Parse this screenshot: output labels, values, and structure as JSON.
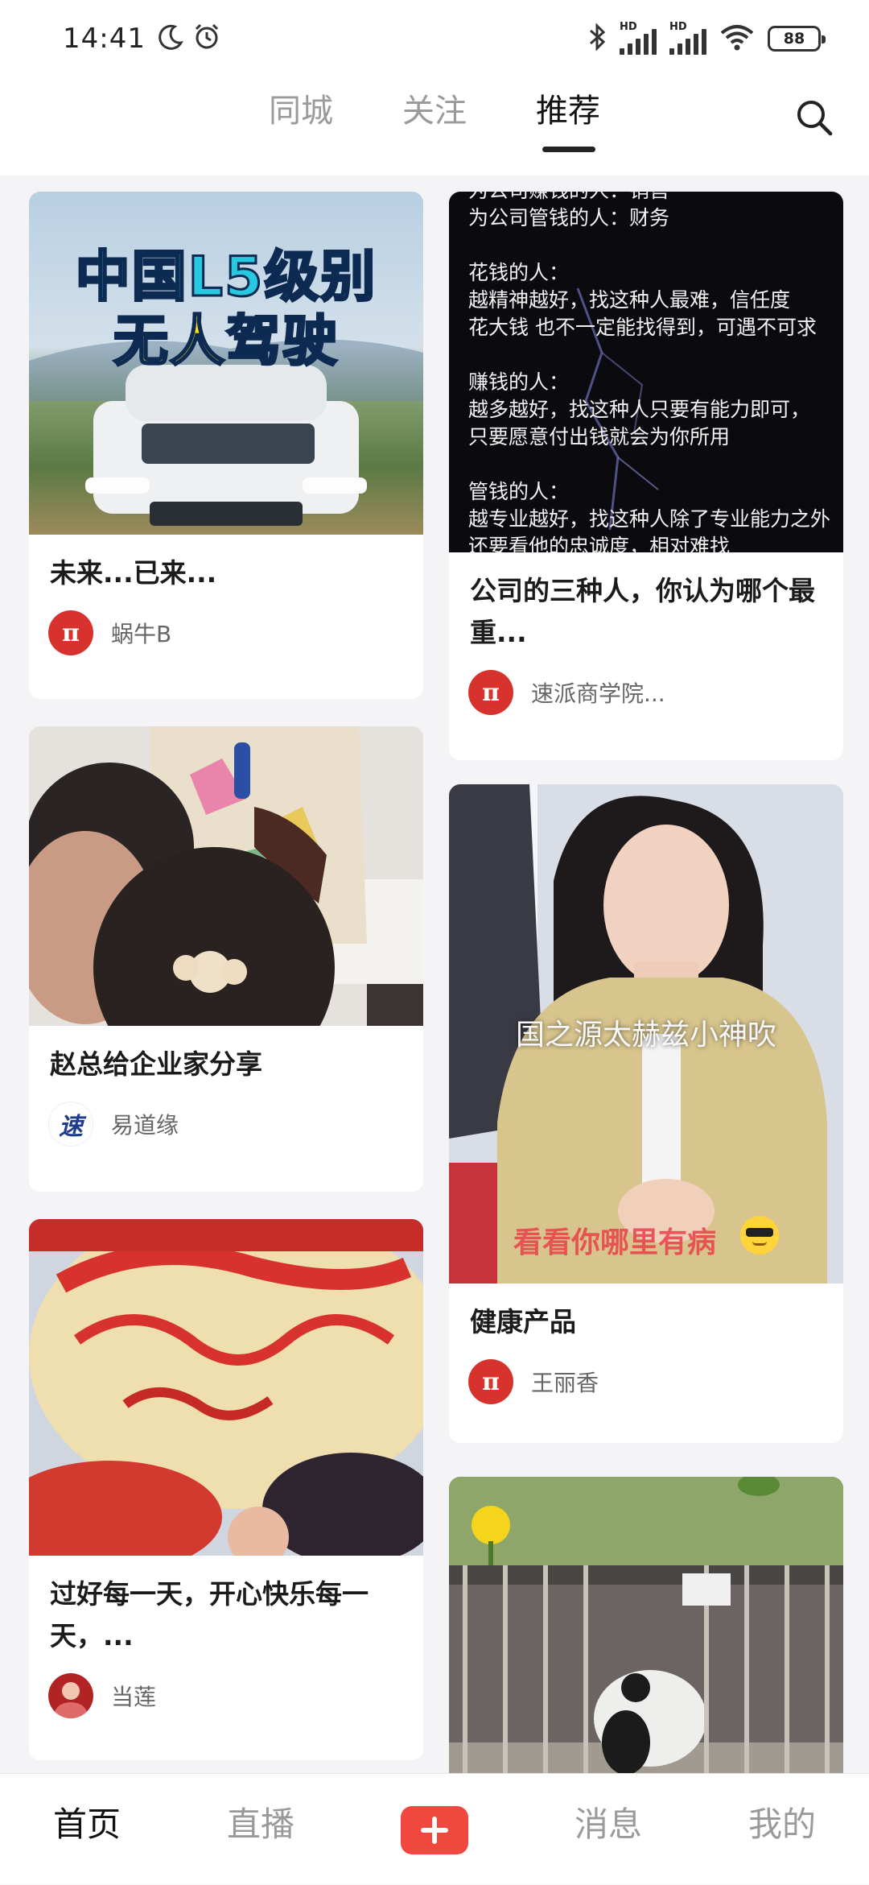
{
  "status_bar": {
    "time": "14:41",
    "battery": "88",
    "hd_label_1": "HD",
    "hd_label_2": "HD",
    "icons": [
      "moon-icon",
      "alarm-icon",
      "bluetooth-icon",
      "signal-icon",
      "signal-icon",
      "wifi-icon",
      "battery-icon"
    ]
  },
  "top_nav": {
    "tabs": [
      {
        "label": "同城"
      },
      {
        "label": "关注"
      },
      {
        "label": "推荐"
      }
    ],
    "active_tab": "推荐"
  },
  "feed": {
    "left": [
      {
        "title": "未来...已来...",
        "author": "蜗牛B",
        "image_caption_line1": "中国L5级别",
        "image_caption_line2": "无人驾驶"
      },
      {
        "title": "赵总给企业家分享",
        "author": "易道缘"
      },
      {
        "title": "过好每一天，开心快乐每一天，...",
        "author": "当莲"
      }
    ],
    "right": [
      {
        "title": "公司的三种人，你认为哪个最重...",
        "author": "速派商学院...",
        "image_text": [
          "为公司赚钱的人：销售",
          "为公司管钱的人：财务",
          "",
          "花钱的人：",
          "越精神越好，找这种人最难，信任度",
          "花大钱 也不一定能找得到，可遇不可求",
          "",
          "赚钱的人：",
          "越多越好，找这种人只要有能力即可，",
          "只要愿意付出钱就会为你所用",
          "",
          "管钱的人：",
          "越专业越好，找这种人除了专业能力之外",
          "还要看他的忠诚度，相对难找"
        ]
      },
      {
        "title": "健康产品",
        "author": "王丽香",
        "image_caption": "国之源太赫兹小神吹",
        "image_caption_2": "看看你哪里有病"
      },
      {
        "title": "",
        "author": ""
      }
    ]
  },
  "bottom_nav": {
    "items": [
      {
        "label": "首页"
      },
      {
        "label": "直播"
      },
      {
        "label": "消息"
      },
      {
        "label": "我的"
      }
    ],
    "active": "首页"
  },
  "colors": {
    "accent": "#f0473f",
    "active_text": "#111111",
    "inactive_text": "#9a9a9a"
  }
}
